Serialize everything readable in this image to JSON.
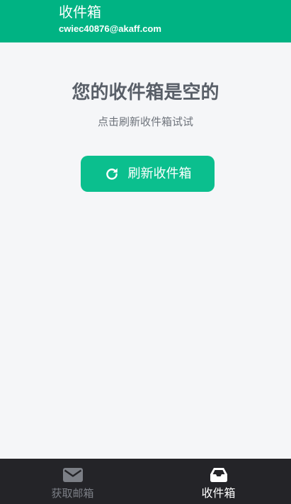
{
  "header": {
    "title": "收件箱",
    "email": "cwiec40876@akaff.com"
  },
  "empty_state": {
    "title": "您的收件箱是空的",
    "hint": "点击刷新收件箱试试",
    "refresh_button": {
      "icon": "refresh-icon",
      "label": "刷新收件箱"
    }
  },
  "bottom_nav": {
    "items": [
      {
        "label": "获取邮箱",
        "icon": "mail-icon",
        "active": false
      },
      {
        "label": "收件箱",
        "icon": "inbox-icon",
        "active": true
      }
    ]
  },
  "colors": {
    "header_bg": "#00b383",
    "button_bg": "#0bbf8e",
    "nav_bg": "#242428",
    "page_bg": "#f5f6f8"
  }
}
